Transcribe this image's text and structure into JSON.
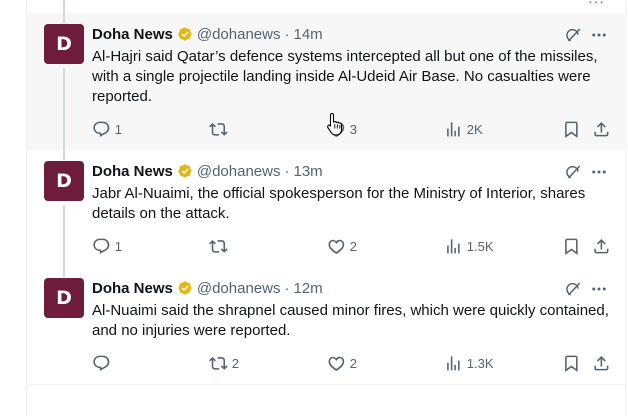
{
  "tweets": [
    {
      "avatar_letter": "D",
      "name": "Doha News",
      "handle": "@dohanews",
      "separator": "·",
      "time": "14m",
      "text": "Al-Hajri said Qatar’s defence systems intercepted all but one of the missiles, with a single projectile landing inside Al-Udeid Air Base. No casualties were reported.",
      "replies": "1",
      "retweets": "",
      "likes": "3",
      "views": "2K"
    },
    {
      "avatar_letter": "D",
      "name": "Doha News",
      "handle": "@dohanews",
      "separator": "·",
      "time": "13m",
      "text": "Jabr Al-Nuaimi, the official spokesperson for the Ministry of Interior, shares details on the attack.",
      "replies": "1",
      "retweets": "",
      "likes": "2",
      "views": "1.5K"
    },
    {
      "avatar_letter": "D",
      "name": "Doha News",
      "handle": "@dohanews",
      "separator": "·",
      "time": "12m",
      "text": "Al-Nuaimi said the shrapnel caused minor fires, which were quickly contained, and no injuries were reported.",
      "replies": "",
      "retweets": "2",
      "likes": "2",
      "views": "1.3K"
    }
  ],
  "top_edge": {
    "overflow_menu": "···"
  },
  "colors": {
    "avatar_bg": "#6e1c3c",
    "verified_gold": "#e2b719",
    "muted": "#536471",
    "thread_line": "#cfd9de",
    "hover_bg": "#f7f7f7"
  },
  "icons": [
    "verified-badge-icon",
    "grok-icon",
    "more-icon",
    "reply-icon",
    "retweet-icon",
    "like-icon",
    "views-icon",
    "bookmark-icon",
    "share-icon",
    "mouse-cursor-icon"
  ]
}
